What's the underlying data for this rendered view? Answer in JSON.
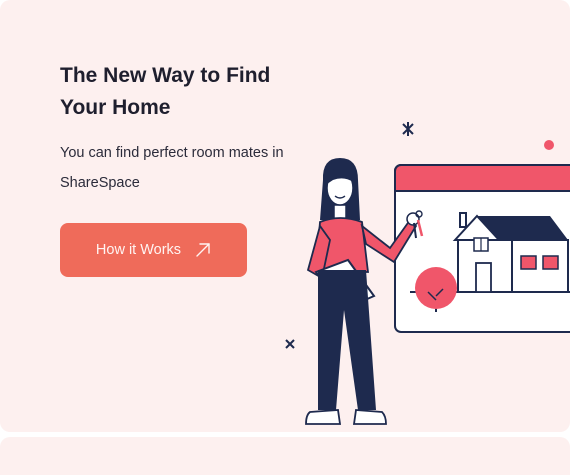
{
  "hero": {
    "title": "The New Way to Find Your Home",
    "subtitle": "You can find perfect room mates in ShareSpace",
    "cta_label": "How it Works",
    "cta_icon": "arrow-up-right-icon"
  },
  "colors": {
    "background": "#fdf0ef",
    "accent": "#ef6b5a",
    "navy": "#1e2a4e",
    "pink": "#f0566a"
  },
  "illustration": {
    "icons": [
      "woman-icon",
      "keys-icon",
      "clipboard-icon",
      "house-icon",
      "tree-icon",
      "star-icon",
      "cross-icon"
    ]
  }
}
